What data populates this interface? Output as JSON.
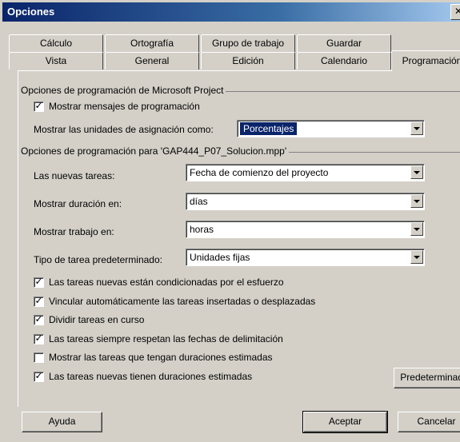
{
  "window": {
    "title": "Opciones"
  },
  "tabs_row1": [
    "Cálculo",
    "Ortografía",
    "Grupo de trabajo",
    "Guardar"
  ],
  "tabs_row2": [
    "Vista",
    "General",
    "Edición",
    "Calendario",
    "Programación"
  ],
  "group1": {
    "legend": "Opciones de programación de Microsoft Project",
    "show_messages": {
      "label": "Mostrar mensajes de programación",
      "checked": true
    },
    "units_label": "Mostrar las unidades de asignación como:",
    "units_value": "Porcentajes"
  },
  "group2": {
    "legend": "Opciones de programación para 'GAP444_P07_Solucion.mpp'",
    "fields": [
      {
        "label": "Las nuevas tareas:",
        "value": "Fecha de comienzo del proyecto"
      },
      {
        "label": "Mostrar duración en:",
        "value": "días"
      },
      {
        "label": "Mostrar trabajo en:",
        "value": "horas"
      },
      {
        "label": "Tipo de tarea predeterminado:",
        "value": "Unidades fijas"
      }
    ],
    "checkboxes": [
      {
        "label": "Las tareas nuevas están condicionadas por el esfuerzo",
        "checked": true
      },
      {
        "label": "Vincular automáticamente las tareas insertadas o desplazadas",
        "checked": true
      },
      {
        "label": "Dividir tareas en curso",
        "checked": true
      },
      {
        "label": "Las tareas siempre respetan las fechas de delimitación",
        "checked": true
      },
      {
        "label": "Mostrar las tareas que tengan duraciones estimadas",
        "checked": false
      },
      {
        "label": "Las tareas nuevas tienen duraciones estimadas",
        "checked": true
      }
    ]
  },
  "buttons": {
    "defaults": "Predeterminado",
    "help": "Ayuda",
    "ok": "Aceptar",
    "cancel": "Cancelar"
  }
}
